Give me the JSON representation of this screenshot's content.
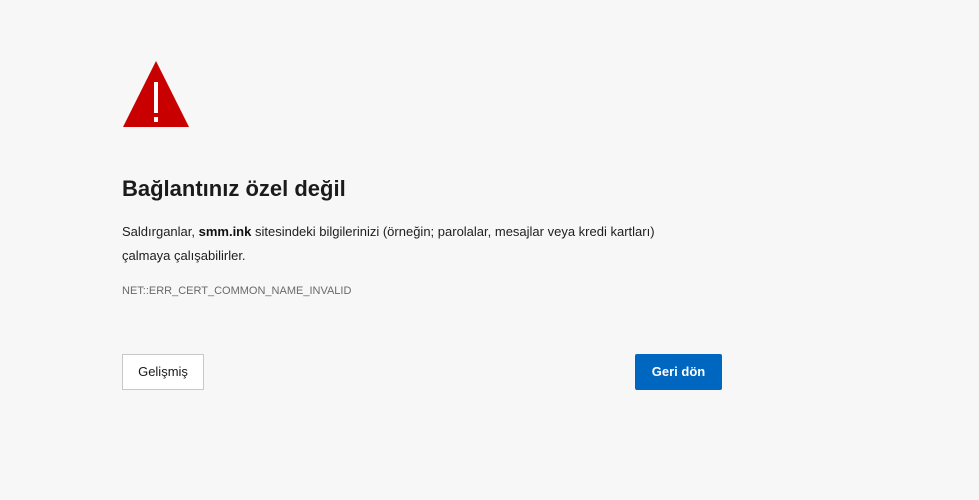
{
  "page": {
    "title": "Bağlantınız özel değil",
    "description": {
      "prefix": "Saldırganlar, ",
      "domain": "smm.ink",
      "suffix_line1": " sitesindeki bilgilerinizi (örneğin; parolalar, mesajlar veya kredi kartları)",
      "suffix_line2": "çalmaya çalışabilirler."
    },
    "error_code": "NET::ERR_CERT_COMMON_NAME_INVALID"
  },
  "buttons": {
    "advanced_label": "Gelişmiş",
    "back_label": "Geri dön"
  },
  "icons": {
    "warning": "warning-triangle-icon"
  },
  "colors": {
    "background": "#f7f7f7",
    "warning_red": "#c80000",
    "primary_button": "#0067c0",
    "text": "#1b1b1b",
    "muted_text": "#6a6a6a"
  }
}
